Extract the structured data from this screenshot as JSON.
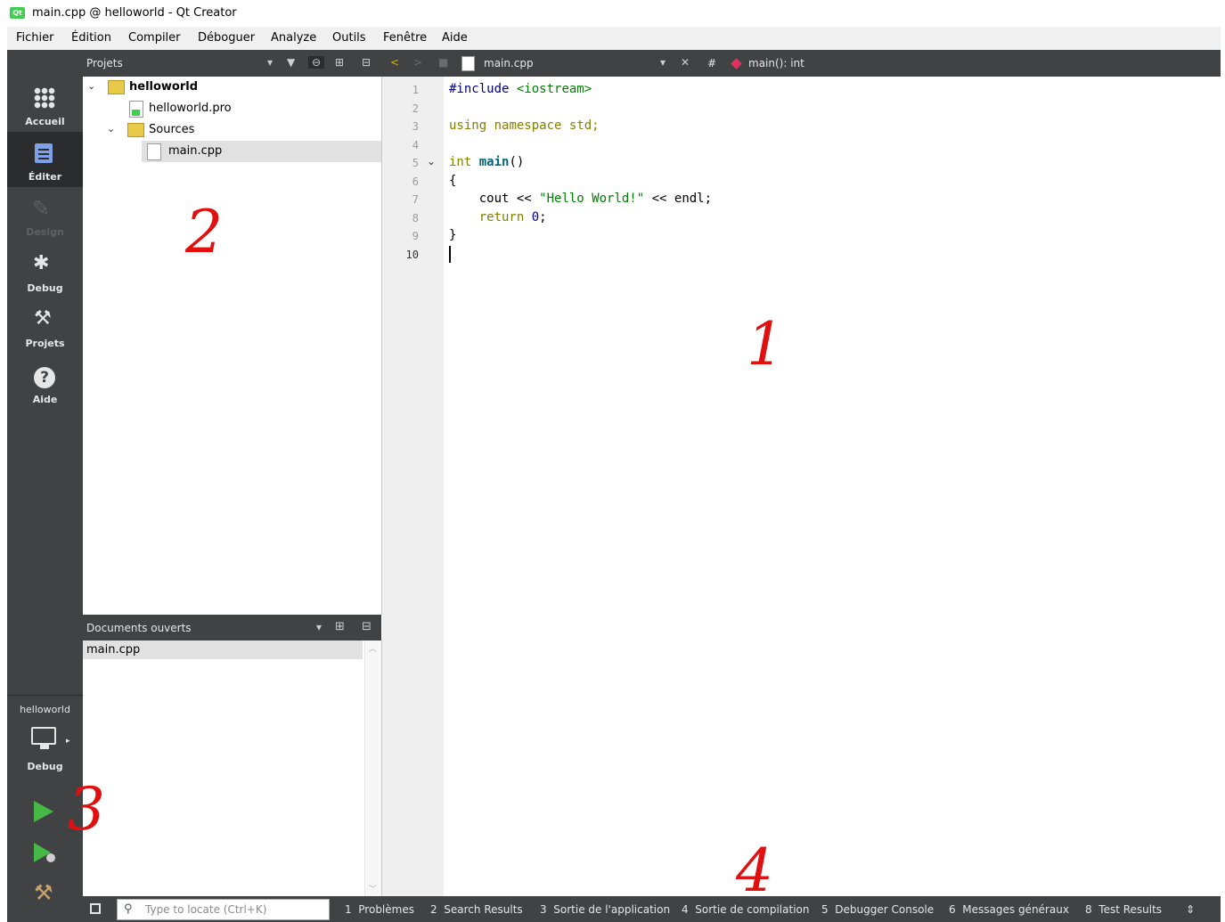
{
  "window": {
    "title": "main.cpp @ helloworld - Qt Creator",
    "logo": "Qt"
  },
  "menu": [
    "Fichier",
    "Édition",
    "Compiler",
    "Déboguer",
    "Analyze",
    "Outils",
    "Fenêtre",
    "Aide"
  ],
  "projects_panel": {
    "title": "Projets",
    "tree": [
      {
        "label": "helloworld",
        "kind": "project",
        "expanded": true
      },
      {
        "label": "helloworld.pro",
        "kind": "pro-file"
      },
      {
        "label": "Sources",
        "kind": "folder",
        "expanded": true
      },
      {
        "label": "main.cpp",
        "kind": "cpp-file",
        "selected": true
      }
    ]
  },
  "editor_toolbar": {
    "file": "main.cpp",
    "hash": "#",
    "symbol": "main(): int"
  },
  "modes": [
    {
      "label": "Accueil",
      "icon": "grid-icon"
    },
    {
      "label": "Éditer",
      "icon": "edit-icon",
      "active": true
    },
    {
      "label": "Design",
      "icon": "pencil-icon",
      "disabled": true
    },
    {
      "label": "Debug",
      "icon": "bug-icon"
    },
    {
      "label": "Projets",
      "icon": "wrench-icon"
    },
    {
      "label": "Aide",
      "icon": "help-icon"
    }
  ],
  "kit": {
    "project": "helloworld",
    "build": "Debug",
    "icon": "monitor-icon"
  },
  "open_documents": {
    "title": "Documents ouverts",
    "items": [
      "main.cpp"
    ]
  },
  "code": {
    "line_numbers": [
      "1",
      "2",
      "3",
      "4",
      "5",
      "6",
      "7",
      "8",
      "9",
      "10"
    ],
    "lines": {
      "l1_pp": "#include",
      "l1_inc": "<iostream>",
      "l3_kw1": "using",
      "l3_kw2": "namespace",
      "l3_rest": "std;",
      "l5_ty": "int",
      "l5_fn": "main",
      "l5_rest": "()",
      "l6": "{",
      "l7_a": "    cout << ",
      "l7_str": "\"Hello World!\"",
      "l7_b": " << endl;",
      "l8_kw": "    return",
      "l8_num": "0",
      "l8_rest": ";",
      "l9": "}"
    }
  },
  "locator": {
    "placeholder": "Type to locate (Ctrl+K)"
  },
  "output_tabs": [
    {
      "num": "1",
      "label": "Problèmes"
    },
    {
      "num": "2",
      "label": "Search Results"
    },
    {
      "num": "3",
      "label": "Sortie de l'application"
    },
    {
      "num": "4",
      "label": "Sortie de compilation"
    },
    {
      "num": "5",
      "label": "Debugger Console"
    },
    {
      "num": "6",
      "label": "Messages généraux"
    },
    {
      "num": "8",
      "label": "Test Results"
    }
  ],
  "annotations": [
    "1",
    "2",
    "3",
    "4"
  ],
  "colors": {
    "dark_panel": "#404244",
    "active_mode": "#2b2c2e",
    "annotation": "#e01010"
  }
}
